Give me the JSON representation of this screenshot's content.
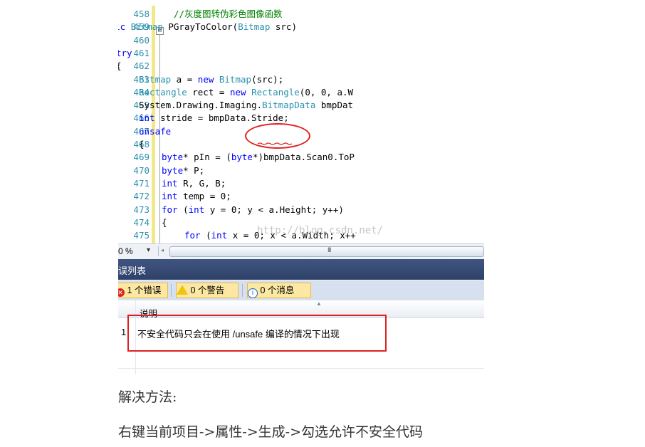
{
  "editor": {
    "lines": [
      {
        "num": "458",
        "indent": 244,
        "tokens": [
          {
            "t": "//灰度图转伪彩色图像函数",
            "c": "cm"
          }
        ]
      },
      {
        "num": "459",
        "indent": 131,
        "tokens": [
          {
            "t": "public ",
            "c": "kw"
          },
          {
            "t": "Bitmap",
            "c": "ty"
          },
          {
            "t": " PGrayToColor(",
            "c": "tx"
          },
          {
            "t": "Bitmap",
            "c": "ty"
          },
          {
            "t": " src)",
            "c": "tx"
          }
        ]
      },
      {
        "num": "460",
        "indent": 131,
        "tokens": [
          {
            "t": "{",
            "c": "tx"
          }
        ]
      },
      {
        "num": "461",
        "indent": 163,
        "tokens": [
          {
            "t": "try",
            "c": "kw"
          }
        ]
      },
      {
        "num": "462",
        "indent": 163,
        "tokens": [
          {
            "t": "{",
            "c": "tx"
          }
        ]
      },
      {
        "num": "463",
        "indent": 195,
        "tokens": [
          {
            "t": "Bitmap",
            "c": "ty"
          },
          {
            "t": " a = ",
            "c": "tx"
          },
          {
            "t": "new ",
            "c": "kw"
          },
          {
            "t": "Bitmap",
            "c": "ty"
          },
          {
            "t": "(src);",
            "c": "tx"
          }
        ]
      },
      {
        "num": "464",
        "indent": 195,
        "tokens": [
          {
            "t": "Rectangle",
            "c": "ty"
          },
          {
            "t": " rect = ",
            "c": "tx"
          },
          {
            "t": "new ",
            "c": "kw"
          },
          {
            "t": "Rectangle",
            "c": "ty"
          },
          {
            "t": "(0, 0, a.W",
            "c": "tx"
          }
        ]
      },
      {
        "num": "465",
        "indent": 195,
        "tokens": [
          {
            "t": "System.Drawing.Imaging.",
            "c": "tx"
          },
          {
            "t": "BitmapData",
            "c": "ty"
          },
          {
            "t": " bmpDat",
            "c": "tx"
          }
        ]
      },
      {
        "num": "466",
        "indent": 195,
        "tokens": [
          {
            "t": "int",
            "c": "kw"
          },
          {
            "t": " stride = bmpData.Stride;",
            "c": "tx"
          }
        ]
      },
      {
        "num": "467",
        "indent": 195,
        "tokens": [
          {
            "t": "unsafe",
            "c": "kw"
          }
        ]
      },
      {
        "num": "468",
        "indent": 195,
        "tokens": [
          {
            "t": "{",
            "c": "tx"
          }
        ]
      },
      {
        "num": "469",
        "indent": 227,
        "tokens": [
          {
            "t": "byte",
            "c": "kw"
          },
          {
            "t": "* pIn = (",
            "c": "tx"
          },
          {
            "t": "byte",
            "c": "kw"
          },
          {
            "t": "*)bmpData.Scan0.ToP",
            "c": "tx"
          }
        ]
      },
      {
        "num": "470",
        "indent": 227,
        "tokens": [
          {
            "t": "byte",
            "c": "kw"
          },
          {
            "t": "* P;",
            "c": "tx"
          }
        ]
      },
      {
        "num": "471",
        "indent": 227,
        "tokens": [
          {
            "t": "int",
            "c": "kw"
          },
          {
            "t": " R, G, B;",
            "c": "tx"
          }
        ]
      },
      {
        "num": "472",
        "indent": 227,
        "tokens": [
          {
            "t": "int",
            "c": "kw"
          },
          {
            "t": " temp = 0;",
            "c": "tx"
          }
        ]
      },
      {
        "num": "473",
        "indent": 227,
        "tokens": [
          {
            "t": "for",
            "c": "kw"
          },
          {
            "t": " (",
            "c": "tx"
          },
          {
            "t": "int",
            "c": "kw"
          },
          {
            "t": " y = 0; y < a.Height; y++)",
            "c": "tx"
          }
        ]
      },
      {
        "num": "474",
        "indent": 227,
        "tokens": [
          {
            "t": "{",
            "c": "tx"
          }
        ]
      },
      {
        "num": "475",
        "indent": 259,
        "tokens": [
          {
            "t": "for",
            "c": "kw"
          },
          {
            "t": " (",
            "c": "tx"
          },
          {
            "t": "int",
            "c": "kw"
          },
          {
            "t": " x = 0; x < a.Width; x++",
            "c": "tx"
          }
        ]
      }
    ],
    "fold_symbol": "⊟",
    "watermark": "http://blog.csdn.net/"
  },
  "scrollbar": {
    "zoom": "0 %",
    "zoom_dropdown": "▾",
    "scroll_left": "◂",
    "grip": "III"
  },
  "error_list": {
    "title": "误列表",
    "filters": {
      "errors": "1 个错误",
      "warnings": "0 个警告",
      "messages": "0 个消息"
    },
    "error_icon": "✕",
    "info_icon": "i",
    "column_description": "说明",
    "sort_indicator": "▲",
    "rows": [
      {
        "num": "1",
        "description": "不安全代码只会在使用 /unsafe 编译的情况下出现"
      }
    ]
  },
  "article": {
    "heading": "解决方法:",
    "body": "右键当前项目->属性->生成->勾选允许不安全代码"
  },
  "colors": {
    "keyword": "#0000ff",
    "type": "#2b91af",
    "comment": "#008000",
    "annotation_red": "#e02020",
    "panel_title": "#3f5581"
  }
}
